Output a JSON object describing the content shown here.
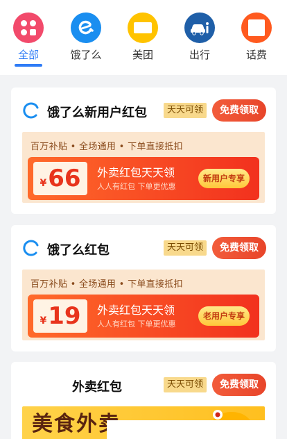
{
  "nav": {
    "items": [
      {
        "label": "全部",
        "icon": "grid-icon",
        "active": true
      },
      {
        "label": "饿了么",
        "icon": "eleme-icon"
      },
      {
        "label": "美团",
        "icon": "meituan-icon"
      },
      {
        "label": "出行",
        "icon": "car-icon"
      },
      {
        "label": "话费",
        "icon": "phone-bill-icon"
      }
    ]
  },
  "cards": [
    {
      "title": "饿了么新用户红包",
      "tag": "天天可领",
      "button": "免费领取",
      "subtitle": "百万补贴 • 全场通用 • 下单直接抵扣",
      "coupon": {
        "currency": "¥",
        "amount": "66",
        "title": "外卖红包天天领",
        "sub": "人人有红包 下单更优惠",
        "tag": "新用户专享"
      }
    },
    {
      "title": "饿了么红包",
      "tag": "天天可领",
      "button": "免费领取",
      "subtitle": "百万补贴 • 全场通用 • 下单直接抵扣",
      "coupon": {
        "currency": "¥",
        "amount": "19",
        "title": "外卖红包天天领",
        "sub": "人人有红包 下单更优惠",
        "tag": "老用户专享"
      }
    },
    {
      "title": "外卖红包",
      "tag": "天天可领",
      "button": "免费领取",
      "banner_text": "美食外卖"
    }
  ],
  "colors": {
    "accent": "#2f7cf6",
    "claim": "#e8452a",
    "tag_bg": "#f8d98c"
  }
}
